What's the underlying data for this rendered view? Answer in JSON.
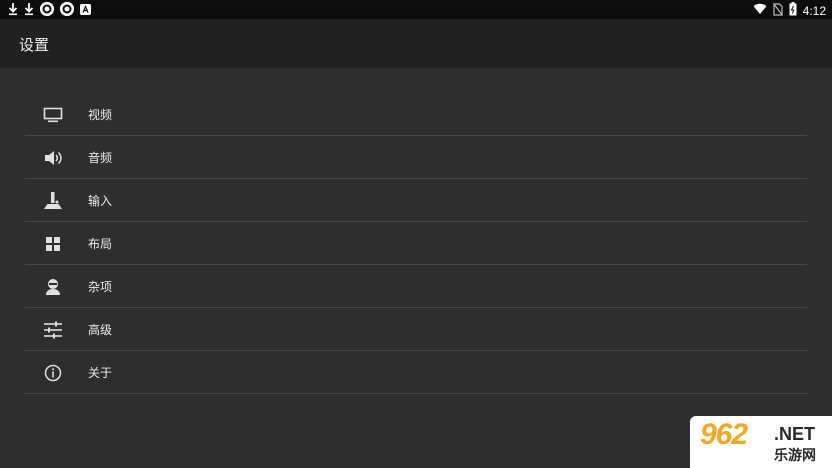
{
  "status_bar": {
    "time": "4:12",
    "left_icons": [
      "download-icon",
      "download-icon",
      "circle-app-icon",
      "circle-app-icon",
      "a-app-icon"
    ],
    "right_icons": [
      "wifi-icon",
      "no-sim-icon",
      "battery-icon"
    ]
  },
  "toolbar": {
    "title": "设置"
  },
  "menu": {
    "items": [
      {
        "label": "视频",
        "icon": "monitor-icon"
      },
      {
        "label": "音频",
        "icon": "speaker-icon"
      },
      {
        "label": "输入",
        "icon": "joystick-icon"
      },
      {
        "label": "布局",
        "icon": "grid-icon"
      },
      {
        "label": "杂项",
        "icon": "person-icon"
      },
      {
        "label": "高级",
        "icon": "sliders-icon"
      },
      {
        "label": "关于",
        "icon": "info-icon"
      }
    ]
  },
  "watermark": {
    "number": "962",
    "domain": ".NET",
    "site_name": "乐游网"
  },
  "colors": {
    "background": "#2e2e2e",
    "toolbar": "#212121",
    "divider": "#474747",
    "accent": "#f5a623"
  }
}
